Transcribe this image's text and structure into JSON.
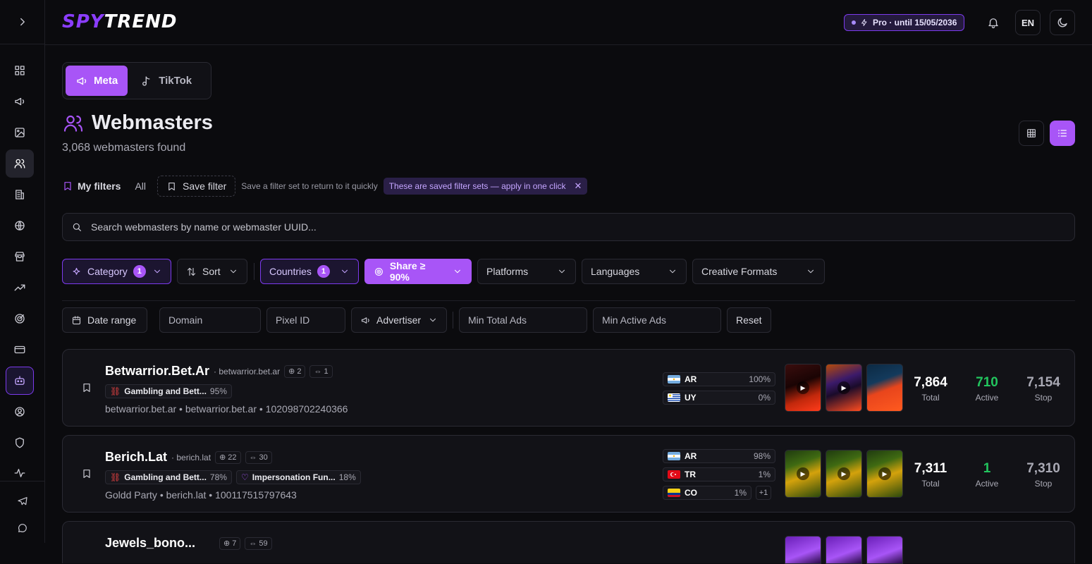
{
  "header": {
    "logo_spy": "SPY",
    "logo_trend": "TREND",
    "pro_badge": "Pro · until 15/05/2036",
    "lang": "EN"
  },
  "platforms": [
    {
      "label": "Meta",
      "active": true
    },
    {
      "label": "TikTok",
      "active": false
    }
  ],
  "page": {
    "title": "Webmasters",
    "subtitle": "3,068 webmasters found"
  },
  "saved_filters": {
    "my_filters": "My filters",
    "all": "All",
    "save_filter": "Save filter",
    "hint": "Save a filter set to return to it quickly",
    "tip": "These are saved filter sets — apply in one click"
  },
  "search": {
    "placeholder": "Search webmasters by name or webmaster UUID..."
  },
  "filters": {
    "category": "Category",
    "category_count": "1",
    "sort": "Sort",
    "countries": "Countries",
    "countries_count": "1",
    "share": "Share ≥ 90%",
    "platforms": "Platforms",
    "languages": "Languages",
    "creative_formats": "Creative Formats",
    "date_range": "Date range",
    "domain_placeholder": "Domain",
    "pixel_placeholder": "Pixel ID",
    "advertiser": "Advertiser",
    "min_total_placeholder": "Min Total Ads",
    "min_active_placeholder": "Min Active Ads",
    "reset": "Reset"
  },
  "webmasters": [
    {
      "name": "Betwarrior.Bet.Ar",
      "domain": "· betwarrior.bet.ar",
      "sites": "2",
      "links": "1",
      "tags": [
        {
          "name": "Gambling and Bett...",
          "pct": "95%"
        }
      ],
      "meta": "betwarrior.bet.ar • betwarrior.bet.ar • 102098702240366",
      "geos": [
        {
          "code": "AR",
          "pct": "100%",
          "flag": "ar"
        },
        {
          "code": "UY",
          "pct": "0%",
          "flag": "uy"
        }
      ],
      "more_geos": "",
      "total": "7,864",
      "total_label": "Total",
      "active": "710",
      "active_label": "Active",
      "stop": "7,154",
      "stop_label": "Stop"
    },
    {
      "name": "Berich.Lat",
      "domain": "· berich.lat",
      "sites": "22",
      "links": "30",
      "tags": [
        {
          "name": "Gambling and Bett...",
          "pct": "78%"
        },
        {
          "name": "Impersonation Fun...",
          "pct": "18%"
        }
      ],
      "meta": "Goldd Party • berich.lat • 100117515797643",
      "geos": [
        {
          "code": "AR",
          "pct": "98%",
          "flag": "ar"
        },
        {
          "code": "TR",
          "pct": "1%",
          "flag": "tr"
        },
        {
          "code": "CO",
          "pct": "1%",
          "flag": "co"
        }
      ],
      "more_geos": "+1",
      "total": "7,311",
      "total_label": "Total",
      "active": "1",
      "active_label": "Active",
      "stop": "7,310",
      "stop_label": "Stop"
    },
    {
      "name": "Jewels_bono...",
      "sites": "7",
      "links": "59"
    }
  ]
}
